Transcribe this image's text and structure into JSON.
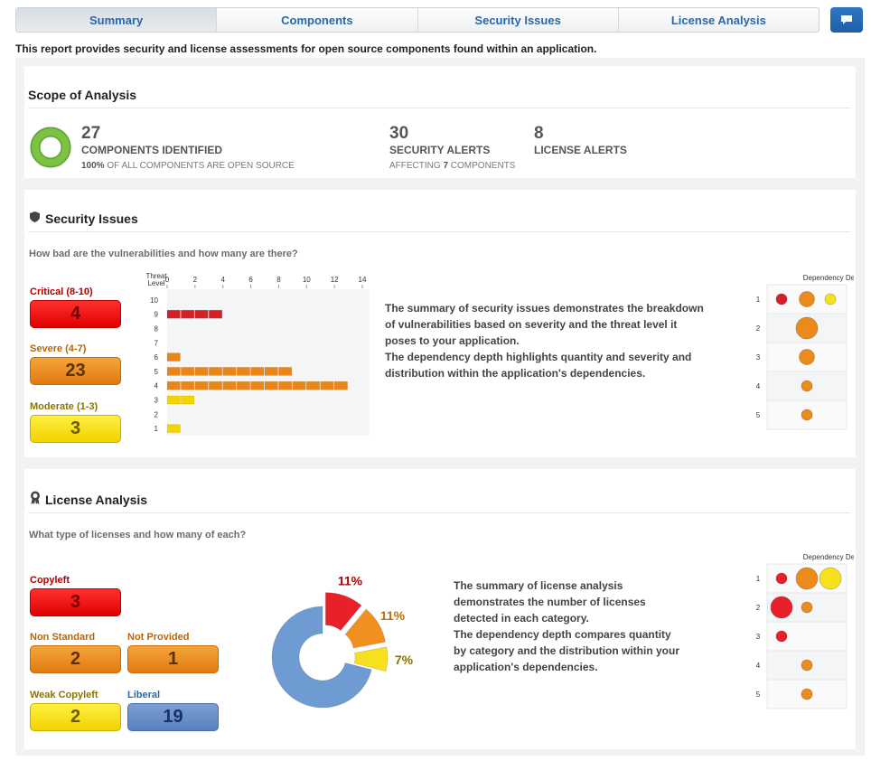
{
  "tabs": [
    "Summary",
    "Components",
    "Security Issues",
    "License Analysis"
  ],
  "chat_icon": "speech-bubble-icon",
  "intro": "This report provides security and license assessments for open source components found within an application.",
  "scope": {
    "title": "Scope of Analysis",
    "components_count": "27",
    "components_label": "COMPONENTS IDENTIFIED",
    "components_pct": "100%",
    "components_sub": "OF ALL COMPONENTS ARE OPEN SOURCE",
    "security_count": "30",
    "security_label": "SECURITY ALERTS",
    "security_sub_pre": "AFFECTING",
    "security_sub_num": "7",
    "security_sub_post": "COMPONENTS",
    "license_count": "8",
    "license_label": "LICENSE ALERTS",
    "open_source_fraction": 1.0
  },
  "security": {
    "title": "Security Issues",
    "question": "How bad are the vulnerabilities and how many are there?",
    "critical_label": "Critical (8-10)",
    "critical_value": "4",
    "severe_label": "Severe (4-7)",
    "severe_value": "23",
    "moderate_label": "Moderate (1-3)",
    "moderate_value": "3",
    "axis_title_1": "Threat",
    "axis_title_2": "Level",
    "desc_lines": [
      "The summary of security issues demonstrates the breakdown",
      "of vulnerabilities based on severity and the threat level it",
      "poses to your application.",
      "The dependency depth highlights quantity and severity and",
      "distribution within the application's dependencies."
    ],
    "depth_title": "Dependency Depth"
  },
  "license": {
    "title": "License Analysis",
    "question": "What type of licenses and how many of each?",
    "copyleft_label": "Copyleft",
    "copyleft_value": "3",
    "nonstandard_label": "Non Standard",
    "nonstandard_value": "2",
    "notprovided_label": "Not Provided",
    "notprovided_value": "1",
    "weak_label": "Weak Copyleft",
    "weak_value": "2",
    "liberal_label": "Liberal",
    "liberal_value": "19",
    "desc_lines": [
      "The summary of license analysis",
      "demonstrates the number of licenses",
      "detected in each category.",
      "The dependency depth compares quantity",
      "by category and the distribution within your",
      "application's dependencies."
    ],
    "depth_title": "Dependency Depth"
  },
  "chart_data": [
    {
      "type": "bar",
      "orientation": "horizontal",
      "xlabel": "",
      "ylabel": "Threat Level",
      "xlim": [
        0,
        14
      ],
      "xticks": [
        "0",
        "2",
        "4",
        "6",
        "8",
        "10",
        "12",
        "14"
      ],
      "categories": [
        "10",
        "9",
        "8",
        "7",
        "6",
        "5",
        "4",
        "3",
        "2",
        "1"
      ],
      "values": [
        0,
        4,
        0,
        0,
        1,
        9,
        13,
        2,
        0,
        1
      ],
      "colors": {
        "critical": "#d42026",
        "severe": "#e8861a",
        "moderate": "#f2d400"
      }
    },
    {
      "type": "pie",
      "donut": true,
      "labels": [
        "Copyleft",
        "Non Standard",
        "Not Provided",
        "Liberal"
      ],
      "values": [
        11,
        11,
        7,
        71
      ],
      "shown_labels": [
        "11%",
        "11%",
        "7%",
        ""
      ],
      "colors": [
        "#e8202a",
        "#f0901e",
        "#f7e01e",
        "#6f9bd3"
      ],
      "exploded": [
        true,
        true,
        true,
        false
      ]
    },
    {
      "type": "scatter",
      "title": "Dependency Depth",
      "rows": [
        "1",
        "2",
        "3",
        "4",
        "5"
      ],
      "points": [
        {
          "row": 1,
          "col": 0,
          "size": "small",
          "color": "#d42026"
        },
        {
          "row": 1,
          "col": 1,
          "size": "medium",
          "color": "#ed8a1c"
        },
        {
          "row": 1,
          "col": 2,
          "size": "small",
          "color": "#f7e01e"
        },
        {
          "row": 2,
          "col": 1,
          "size": "large",
          "color": "#ed8a1c"
        },
        {
          "row": 3,
          "col": 1,
          "size": "medium",
          "color": "#ed8a1c"
        },
        {
          "row": 4,
          "col": 1,
          "size": "small",
          "color": "#ed8a1c"
        },
        {
          "row": 5,
          "col": 1,
          "size": "small",
          "color": "#ed8a1c"
        }
      ]
    },
    {
      "type": "scatter",
      "title": "Dependency Depth",
      "rows": [
        "1",
        "2",
        "3",
        "4",
        "5"
      ],
      "points": [
        {
          "row": 1,
          "col": 0,
          "size": "small",
          "color": "#e8202a"
        },
        {
          "row": 1,
          "col": 1,
          "size": "large",
          "color": "#ed8a1c"
        },
        {
          "row": 1,
          "col": 2,
          "size": "large",
          "color": "#f7e01e"
        },
        {
          "row": 2,
          "col": 0,
          "size": "large",
          "color": "#e8202a"
        },
        {
          "row": 2,
          "col": 1,
          "size": "small",
          "color": "#ed8a1c"
        },
        {
          "row": 3,
          "col": 0,
          "size": "small",
          "color": "#e8202a"
        },
        {
          "row": 4,
          "col": 1,
          "size": "small",
          "color": "#ed8a1c"
        },
        {
          "row": 5,
          "col": 1,
          "size": "small",
          "color": "#ed8a1c"
        }
      ]
    }
  ]
}
